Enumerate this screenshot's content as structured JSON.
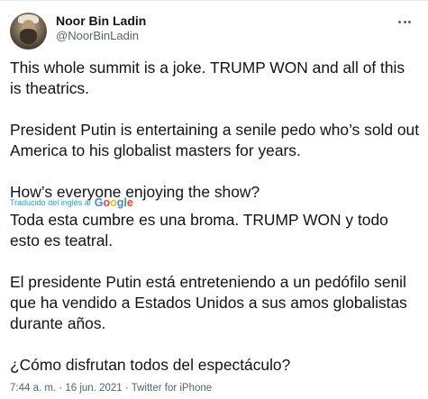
{
  "author": {
    "name": "Noor Bin Ladin",
    "handle": "@NoorBinLadin"
  },
  "tweet": {
    "paragraphs": [
      "This whole summit is a joke. TRUMP WON and all of this is theatrics.",
      "President Putin is entertaining a senile pedo who’s sold out America to his globalist masters for years.",
      "How’s everyone enjoying the show?"
    ]
  },
  "translation_notice": {
    "label": "Traducido del inglés al",
    "provider": "Google",
    "provider_letters": [
      "G",
      "o",
      "o",
      "g",
      "l",
      "e"
    ]
  },
  "translation": {
    "paragraphs": [
      "Toda esta cumbre es una broma. TRUMP WON y todo esto es teatral.",
      " El presidente Putin está entreteniendo a un pedófilo senil que ha vendido a Estados Unidos a sus amos globalistas durante años.",
      " ¿Cómo disfrutan todos del espectáculo?"
    ]
  },
  "meta": {
    "time": "7:44 a. m.",
    "separator": " · ",
    "date": "16 jun. 2021",
    "source": "Twitter for iPhone"
  },
  "icons": {
    "more": "more-dots-icon",
    "google": "google-wordmark"
  }
}
